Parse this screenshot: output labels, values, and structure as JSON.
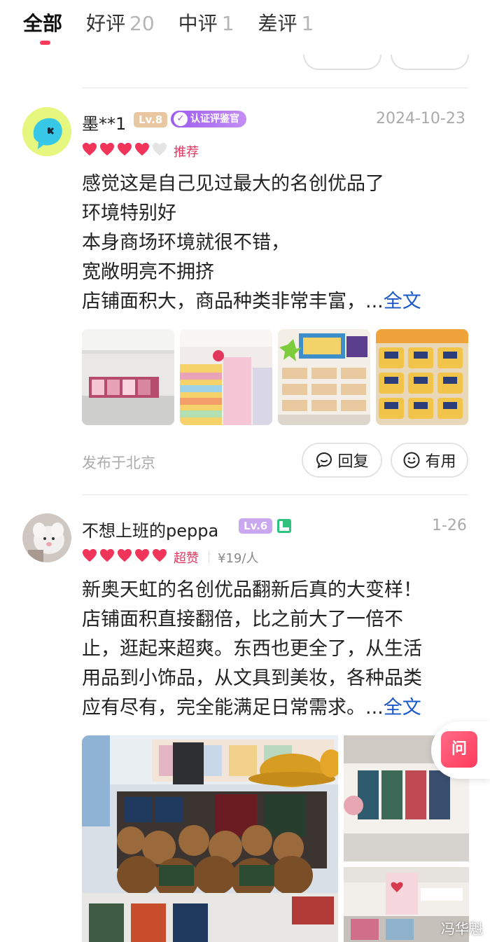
{
  "tabs": [
    {
      "label": "全部",
      "count": ""
    },
    {
      "label": "好评",
      "count": "20"
    },
    {
      "label": "中评",
      "count": "1"
    },
    {
      "label": "差评",
      "count": "1"
    }
  ],
  "reviews": [
    {
      "username": "墨**1",
      "level": "Lv.8",
      "cert": "认证评鉴官",
      "date": "2024-10-23",
      "hearts_filled": 4,
      "hearts_total": 5,
      "rating_tag": "推荐",
      "lines": [
        "感觉这是自己见过最大的名创优品了",
        "环境特别好",
        "本身商场环境就很不错，",
        "宽敞明亮不拥挤",
        "店铺面积大，商品种类非常丰富，..."
      ],
      "more": "全文",
      "location": "发布于北京",
      "reply_label": "回复",
      "useful_label": "有用"
    },
    {
      "username": "不想上班的peppa",
      "level": "Lv.6",
      "date": "1-26",
      "hearts_filled": 5,
      "hearts_total": 5,
      "rating_tag": "超赞",
      "price": "¥19/人",
      "lines": [
        "新奥天虹的名创优品翻新后真的大变样！",
        "店铺面积直接翻倍，比之前大了一倍不",
        "止，逛起来超爽。东西也更全了，从生活",
        "用品到小饰品，从文具到美妆，各种品类",
        "应有尽有，完全能满足日常需求。..."
      ],
      "more": "全文"
    }
  ],
  "float_button": "问",
  "watermark": "冯华魁",
  "colors": {
    "accent": "#ff3b5c",
    "link": "#1a57c7",
    "cert": "#9c5cf0"
  }
}
